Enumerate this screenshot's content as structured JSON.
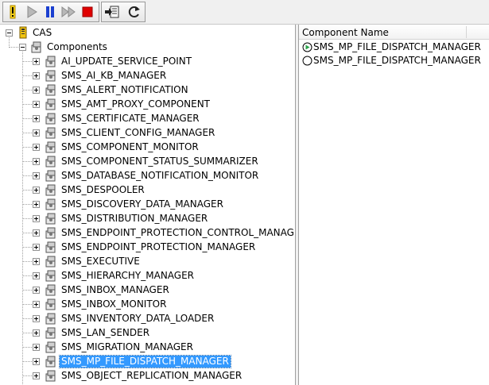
{
  "toolbar": {
    "buttons": [
      {
        "name": "warning-button",
        "icon": "exclamation-icon"
      },
      {
        "name": "play-button",
        "icon": "play-icon"
      },
      {
        "name": "pause-button",
        "icon": "pause-icon"
      },
      {
        "name": "fast-forward-button",
        "icon": "fast-forward-icon"
      },
      {
        "name": "stop-button",
        "icon": "stop-icon"
      },
      {
        "name": "export-button",
        "icon": "export-icon"
      },
      {
        "name": "refresh-button",
        "icon": "refresh-icon"
      }
    ]
  },
  "tree": {
    "root_label": "CAS",
    "components_label": "Components",
    "selected_index": 21,
    "items": [
      "AI_UPDATE_SERVICE_POINT",
      "SMS_AI_KB_MANAGER",
      "SMS_ALERT_NOTIFICATION",
      "SMS_AMT_PROXY_COMPONENT",
      "SMS_CERTIFICATE_MANAGER",
      "SMS_CLIENT_CONFIG_MANAGER",
      "SMS_COMPONENT_MONITOR",
      "SMS_COMPONENT_STATUS_SUMMARIZER",
      "SMS_DATABASE_NOTIFICATION_MONITOR",
      "SMS_DESPOOLER",
      "SMS_DISCOVERY_DATA_MANAGER",
      "SMS_DISTRIBUTION_MANAGER",
      "SMS_ENDPOINT_PROTECTION_CONTROL_MANAGER",
      "SMS_ENDPOINT_PROTECTION_MANAGER",
      "SMS_EXECUTIVE",
      "SMS_HIERARCHY_MANAGER",
      "SMS_INBOX_MANAGER",
      "SMS_INBOX_MONITOR",
      "SMS_INVENTORY_DATA_LOADER",
      "SMS_LAN_SENDER",
      "SMS_MIGRATION_MANAGER",
      "SMS_MP_FILE_DISPATCH_MANAGER",
      "SMS_OBJECT_REPLICATION_MANAGER"
    ]
  },
  "list": {
    "column_header": "Component Name",
    "rows": [
      {
        "label": "SMS_MP_FILE_DISPATCH_MANAGER",
        "status_icon": "running-status-icon"
      },
      {
        "label": "SMS_MP_FILE_DISPATCH_MANAGER",
        "status_icon": "idle-status-icon"
      }
    ]
  },
  "colors": {
    "selection": "#3399ff",
    "stop": "#e00000",
    "pause": "#1a3fd0",
    "warning": "#f7d21a"
  }
}
